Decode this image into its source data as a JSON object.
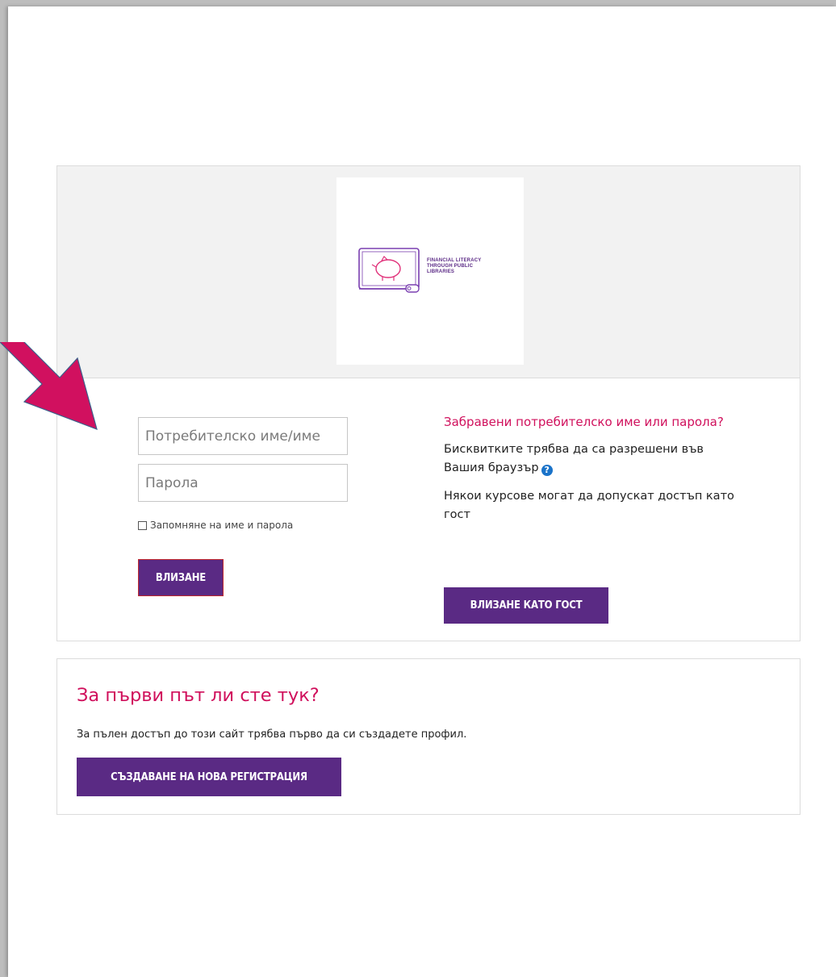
{
  "logo": {
    "lines": [
      "FINANCIAL LITERACY",
      "THROUGH PUBLIC",
      "LIBRARIES"
    ],
    "icon": "piggy-bank-laptop-icon"
  },
  "login": {
    "username_placeholder": "Потребителско име/име",
    "password_placeholder": "Парола",
    "remember_label": "Запомняне на име и парола",
    "login_button": "Влизане"
  },
  "help": {
    "forgot_link": "Забравени потребителско име или парола?",
    "cookies_text": "Бисквитките трябва да са разрешени във Вашия браузър",
    "guest_text": "Някои курсове могат да допускат достъп като гост",
    "guest_button": "Влизане като гост"
  },
  "signup": {
    "title": "За първи път ли сте тук?",
    "description": "За пълен достъп до този сайт трябва първо да си създадете профил.",
    "button": "Създаване на нова регистрация"
  },
  "colors": {
    "accent_purple": "#5a2a84",
    "accent_pink": "#d0105c",
    "arrow": "#d1105f"
  }
}
